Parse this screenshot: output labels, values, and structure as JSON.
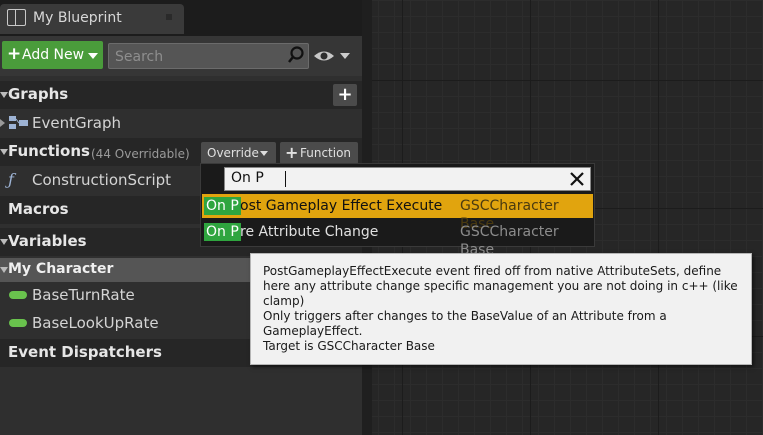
{
  "tab": {
    "title": "My Blueprint"
  },
  "toolbar": {
    "add_new_label": "Add New",
    "search_placeholder": "Search"
  },
  "sections": {
    "graphs": {
      "title": "Graphs",
      "items": [
        "EventGraph"
      ]
    },
    "functions": {
      "title": "Functions",
      "overridable": "(44 Overridable)",
      "override_label": "Override",
      "function_label": "Function",
      "items": [
        "ConstructionScript"
      ]
    },
    "macros": {
      "title": "Macros"
    },
    "variables": {
      "title": "Variables",
      "category": "My Character",
      "items": [
        "BaseTurnRate",
        "BaseLookUpRate"
      ]
    },
    "dispatchers": {
      "title": "Event Dispatchers"
    }
  },
  "popup": {
    "query": "On P",
    "results": [
      {
        "match": "On P",
        "rest": "ost Gameplay Effect Execute",
        "source": "GSCCharacter Base",
        "selected": true
      },
      {
        "match": "On P",
        "rest": "re Attribute Change",
        "source": "GSCCharacter Base",
        "selected": false
      }
    ]
  },
  "tooltip": {
    "line1": "PostGameplayEffectExecute event fired off from native AttributeSets, define here any attribute change specific management you are not doing in c++ (like clamp)",
    "line2": "Only triggers after changes to the BaseValue of an Attribute from a GameplayEffect.",
    "line3": "Target is GSCCharacter Base"
  },
  "colors": {
    "accent_green": "#4a9c3b",
    "match_green": "#2fa53f",
    "selected_orange": "#e1a40e",
    "variable_pill": "#69c24d"
  }
}
